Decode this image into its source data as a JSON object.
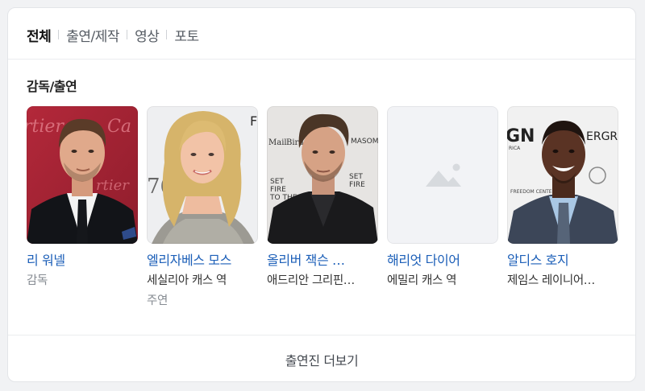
{
  "tabs": [
    {
      "label": "전체",
      "active": true
    },
    {
      "label": "출연/제작",
      "active": false
    },
    {
      "label": "영상",
      "active": false
    },
    {
      "label": "포토",
      "active": false
    }
  ],
  "section": {
    "title": "감독/출연"
  },
  "people": [
    {
      "name": "리 워넬",
      "role": "감독",
      "role2": "",
      "photo": "leigh-whannell-photo"
    },
    {
      "name": "엘리자베스 모스",
      "role": "세실리아 캐스 역",
      "role2": "주연",
      "photo": "elisabeth-moss-photo"
    },
    {
      "name": "올리버 잭슨 …",
      "role": "애드리안 그리핀…",
      "role2": "",
      "photo": "oliver-jackson-photo"
    },
    {
      "name": "해리엇 다이어",
      "role": "에밀리 캐스 역",
      "role2": "",
      "photo": "placeholder-photo"
    },
    {
      "name": "알디스 호지",
      "role": "제임스 레이니어…",
      "role2": "",
      "photo": "aldis-hodge-photo"
    }
  ],
  "footer": {
    "more_label": "출연진 더보기"
  },
  "colors": {
    "name_link": "#1c5fb8",
    "tab_active": "#111111",
    "tab_inactive": "#555b63",
    "secondary_text": "#868b92",
    "placeholder_bg": "#f2f3f6"
  }
}
